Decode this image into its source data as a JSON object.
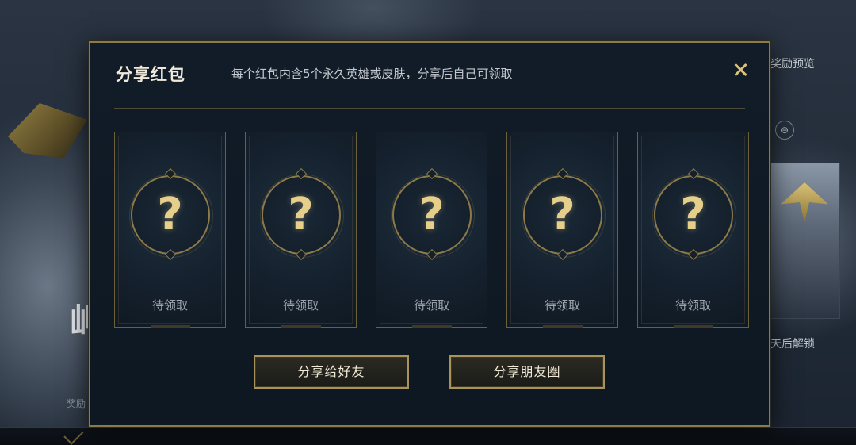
{
  "background": {
    "right_panel_title": "奖励预览",
    "right_panel_label": "天后解锁",
    "left_glyph": "岬",
    "left_small_text": "奖励"
  },
  "modal": {
    "title": "分享红包",
    "subtitle": "每个红包内含5个永久英雄或皮肤，分享后自己可领取",
    "close_icon": "close-icon",
    "cards": [
      {
        "symbol": "?",
        "label": "待领取"
      },
      {
        "symbol": "?",
        "label": "待领取"
      },
      {
        "symbol": "?",
        "label": "待领取"
      },
      {
        "symbol": "?",
        "label": "待领取"
      },
      {
        "symbol": "?",
        "label": "待领取"
      }
    ],
    "buttons": {
      "share_friend": "分享给好友",
      "share_moments": "分享朋友圈"
    }
  },
  "colors": {
    "accent_gold": "#d9c27a",
    "modal_bg": "#111c28",
    "border_gold": "#8a7a4c"
  }
}
